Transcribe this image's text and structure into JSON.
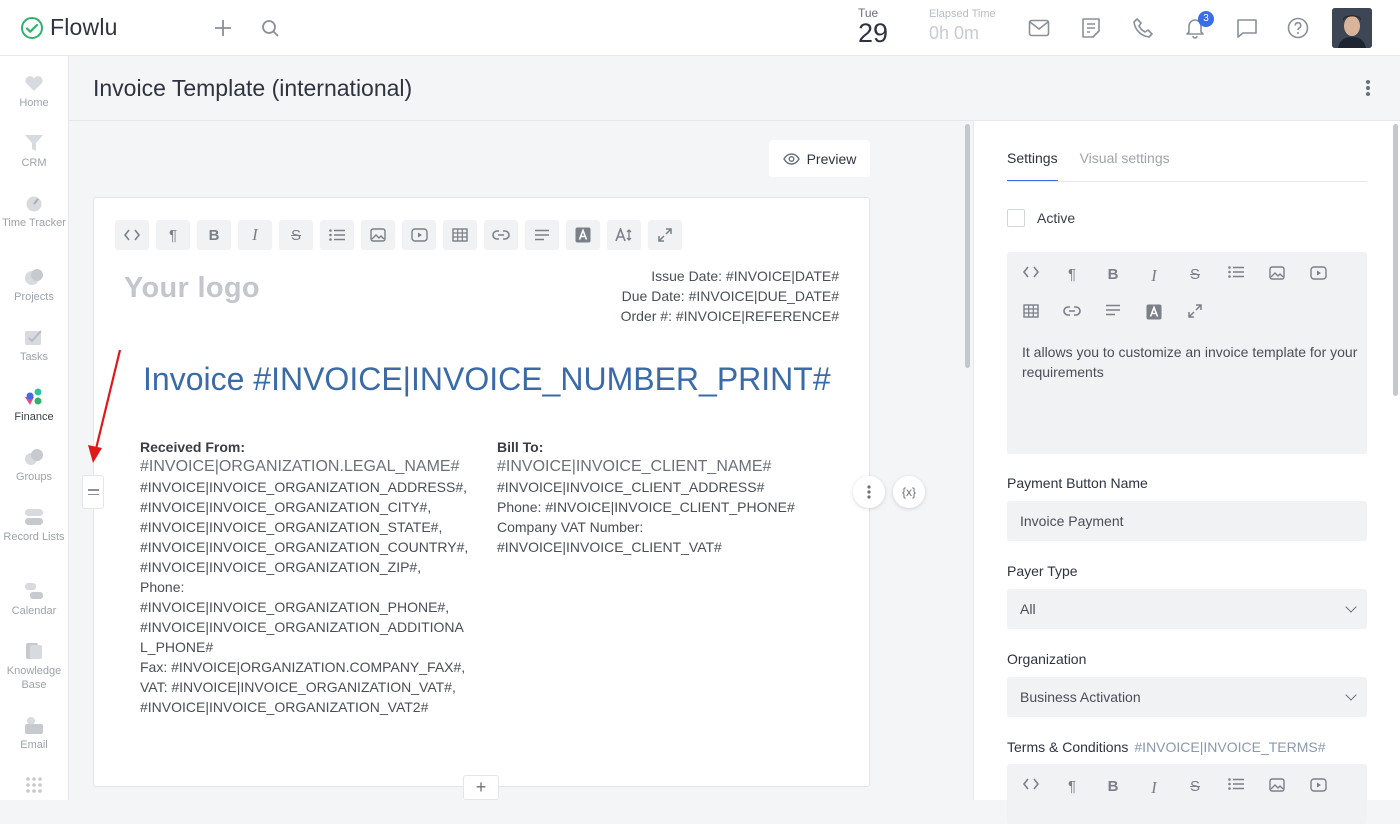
{
  "app": {
    "name": "Flowlu"
  },
  "topbar": {
    "date_day": "Tue",
    "date_num": "29",
    "elapsed_label": "Elapsed Time",
    "elapsed_value": "0h 0m",
    "notifications_count": "3",
    "icons": [
      "plus-icon",
      "search-icon",
      "mail-icon",
      "notes-icon",
      "phone-icon",
      "bell-icon",
      "chat-icon",
      "help-icon"
    ]
  },
  "sidebar": {
    "items": [
      {
        "label": "Home"
      },
      {
        "label": "CRM"
      },
      {
        "label": "Time Tracker"
      },
      {
        "label": "Projects"
      },
      {
        "label": "Tasks"
      },
      {
        "label": "Finance"
      },
      {
        "label": "Groups"
      },
      {
        "label": "Record Lists"
      },
      {
        "label": "Calendar"
      },
      {
        "label": "Knowledge Base"
      },
      {
        "label": "Email"
      }
    ]
  },
  "header": {
    "title": "Invoice Template (international)"
  },
  "preview": {
    "label": "Preview"
  },
  "editor": {
    "logo_text": "Your logo",
    "issue_date": "Issue Date: #INVOICE|DATE#",
    "due_date": "Due Date: #INVOICE|DUE_DATE#",
    "order": "Order #: #INVOICE|REFERENCE#",
    "invoice_title": "Invoice #INVOICE|INVOICE_NUMBER_PRINT#",
    "received_from": {
      "heading": "Received From:",
      "name": "#INVOICE|ORGANIZATION.LEGAL_NAME#",
      "lines": [
        "#INVOICE|INVOICE_ORGANIZATION_ADDRESS#,",
        "#INVOICE|INVOICE_ORGANIZATION_CITY#,",
        "#INVOICE|INVOICE_ORGANIZATION_STATE#,",
        "#INVOICE|INVOICE_ORGANIZATION_COUNTRY#,",
        "#INVOICE|INVOICE_ORGANIZATION_ZIP#,",
        "Phone:",
        "#INVOICE|INVOICE_ORGANIZATION_PHONE#,",
        "#INVOICE|INVOICE_ORGANIZATION_ADDITIONA",
        "L_PHONE#",
        "Fax: #INVOICE|ORGANIZATION.COMPANY_FAX#,",
        "VAT: #INVOICE|INVOICE_ORGANIZATION_VAT#,",
        "#INVOICE|INVOICE_ORGANIZATION_VAT2#"
      ]
    },
    "bill_to": {
      "heading": "Bill To:",
      "name": "#INVOICE|INVOICE_CLIENT_NAME#",
      "lines": [
        "#INVOICE|INVOICE_CLIENT_ADDRESS#",
        "Phone: #INVOICE|INVOICE_CLIENT_PHONE#",
        "Company VAT Number:",
        "#INVOICE|INVOICE_CLIENT_VAT#"
      ]
    },
    "variables_button": "{x}",
    "add_button": "+"
  },
  "panel": {
    "tabs": [
      {
        "label": "Settings"
      },
      {
        "label": "Visual settings"
      }
    ],
    "active_label": "Active",
    "description": "It allows you to customize an invoice template for your requirements",
    "payment_button_label": "Payment Button Name",
    "payment_button_value": "Invoice Payment",
    "payer_type_label": "Payer Type",
    "payer_type_value": "All",
    "organization_label": "Organization",
    "organization_value": "Business Activation",
    "terms_label": "Terms & Conditions",
    "terms_tag": "#INVOICE|INVOICE_TERMS#"
  },
  "colors": {
    "accent": "#3b6ee6",
    "invoice_title": "#3a6aa8",
    "logo_green": "#2fb36b",
    "arrow": "#e01818"
  }
}
